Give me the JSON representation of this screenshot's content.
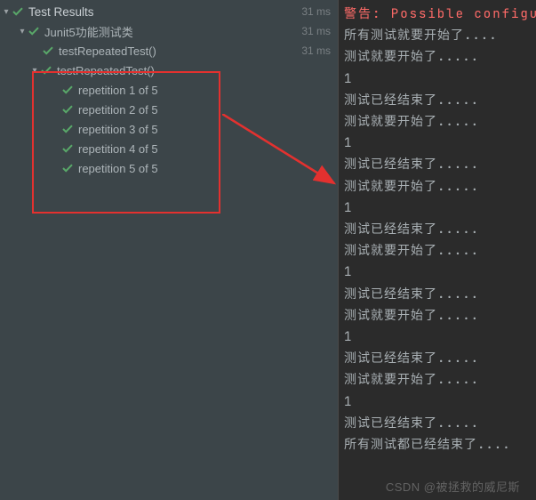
{
  "tree": {
    "root": {
      "label": "Test Results",
      "time": "31 ms"
    },
    "suite": {
      "label": "Junit5功能测试类",
      "time": "31 ms"
    },
    "test_a": {
      "label": "testRepeatedTest()",
      "time": "31 ms"
    },
    "test_b": {
      "label": "testRepeatedTest()"
    },
    "reps": [
      {
        "label": "repetition 1 of 5"
      },
      {
        "label": "repetition 2 of 5"
      },
      {
        "label": "repetition 3 of 5"
      },
      {
        "label": "repetition 4 of 5"
      },
      {
        "label": "repetition 5 of 5"
      }
    ]
  },
  "console": {
    "warn": "警告: Possible configu",
    "lines": [
      "所有测试就要开始了....",
      "测试就要开始了.....",
      "1",
      "测试已经结束了.....",
      "测试就要开始了.....",
      "1",
      "测试已经结束了.....",
      "测试就要开始了.....",
      "1",
      "测试已经结束了.....",
      "测试就要开始了.....",
      "1",
      "测试已经结束了.....",
      "测试就要开始了.....",
      "1",
      "测试已经结束了.....",
      "测试就要开始了.....",
      "1",
      "测试已经结束了.....",
      "所有测试都已经结束了...."
    ]
  },
  "watermark": "CSDN @被拯救的威尼斯"
}
